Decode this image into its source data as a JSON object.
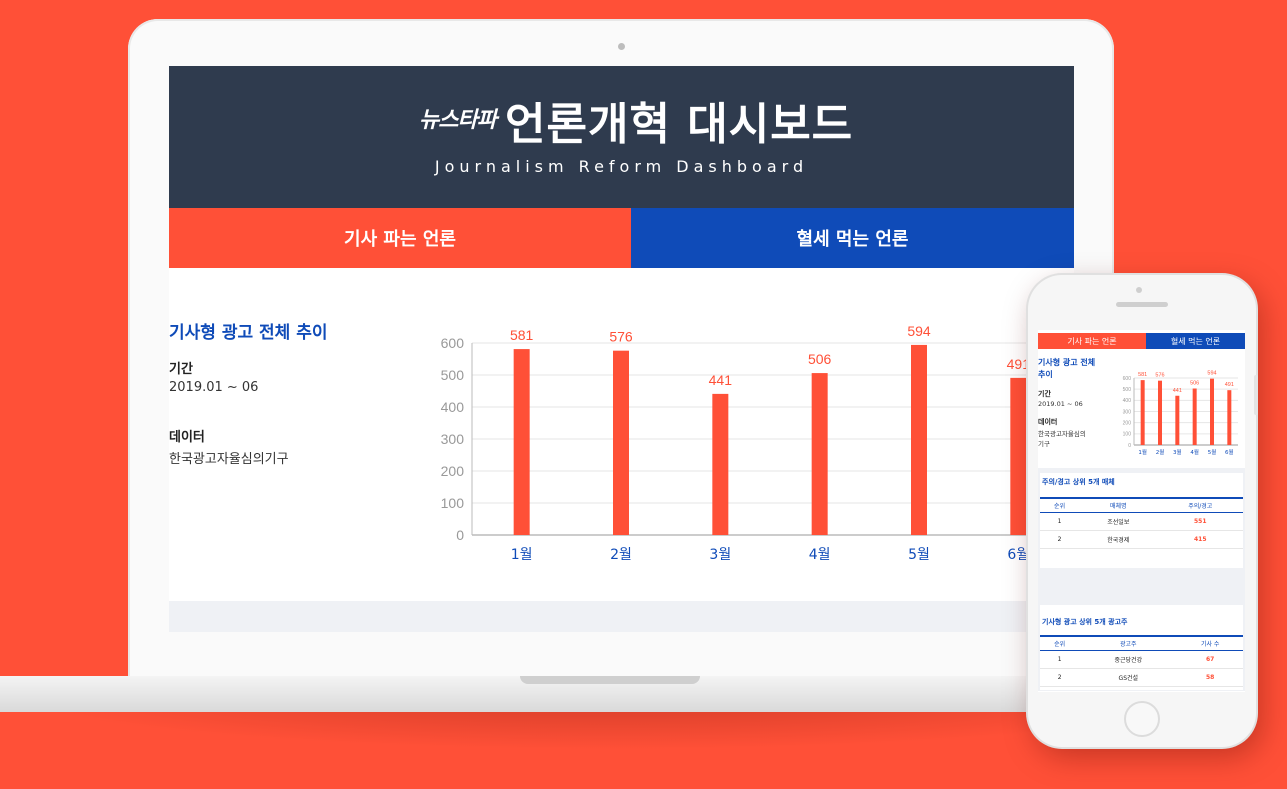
{
  "brand": {
    "logo_text": "뉴스타파",
    "title": "언론개혁 대시보드",
    "subtitle": "Journalism Reform Dashboard"
  },
  "tabs": [
    {
      "label": "기사 파는 언론"
    },
    {
      "label": "혈세 먹는 언론"
    }
  ],
  "panel": {
    "title": "기사형 광고 전체 추이",
    "period_label": "기간",
    "period_value": "2019.01 ~ 06",
    "data_label": "데이터",
    "data_value": "한국광고자율심의기구"
  },
  "chart_data": {
    "type": "bar",
    "categories": [
      "1월",
      "2월",
      "3월",
      "4월",
      "5월",
      "6월"
    ],
    "values": [
      581,
      576,
      441,
      506,
      594,
      491
    ],
    "yticks": [
      0,
      100,
      200,
      300,
      400,
      500,
      600
    ],
    "ylim": [
      0,
      600
    ],
    "grid": true,
    "bar_color": "#FF5037",
    "label_color": "#FF5037",
    "category_color": "#0F4BB8"
  },
  "mobile": {
    "tabs": [
      {
        "label": "기사 파는 언론"
      },
      {
        "label": "혈세 먹는 언론"
      }
    ],
    "panel_title_1": "기사형 광고 전체",
    "panel_title_2": "추이",
    "period_label": "기간",
    "period_value": "2019.01 ~ 06",
    "data_label": "데이터",
    "data_value_1": "한국광고자율심의",
    "data_value_2": "기구",
    "table1": {
      "title": "주의/경고 상위 5개 매체",
      "headers": [
        "순위",
        "매체명",
        "주의/경고"
      ],
      "rows": [
        [
          "1",
          "조선일보",
          "551"
        ],
        [
          "2",
          "한국경제",
          "415"
        ]
      ]
    },
    "table2": {
      "title": "기사형 광고 상위 5개 광고주",
      "headers": [
        "순위",
        "광고주",
        "기사 수"
      ],
      "rows": [
        [
          "1",
          "중근당건강",
          "67"
        ],
        [
          "2",
          "GS건설",
          "58"
        ]
      ]
    }
  },
  "colors": {
    "background": "#FF5037",
    "navy": "#2F3B4E",
    "blue": "#0F4BB8",
    "accent": "#FF5037"
  }
}
